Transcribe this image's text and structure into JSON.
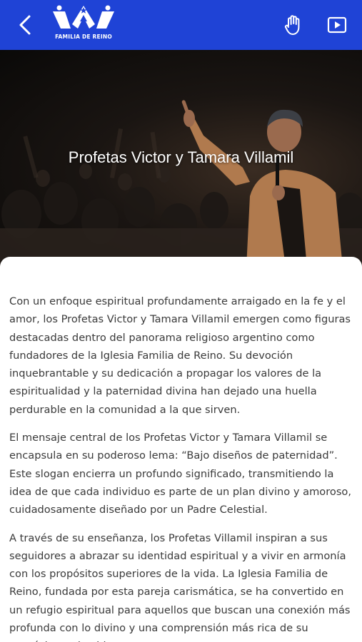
{
  "topbar": {
    "background": "#1f43d6",
    "back_icon": "chevron-left-icon",
    "logo_text": "FAMILIA DE REINO",
    "hand_icon": "hand-icon",
    "play_icon": "play-video-icon"
  },
  "hero": {
    "title": "Profetas Victor y Tamara Villamil"
  },
  "content": {
    "paragraphs": [
      "Con un enfoque espiritual profundamente arraigado en la fe y el amor, los Profetas Victor y Tamara Villamil emergen como figuras destacadas dentro del panorama religioso argentino como fundadores de la Iglesia Familia de Reino. Su devoción inquebrantable y su dedicación a propagar los valores de la espiritualidad y la paternidad divina han dejado una huella perdurable en la comunidad a la que sirven.",
      "El mensaje central de los Profetas Victor y Tamara Villamil se encapsula en su poderoso lema: “Bajo diseños de paternidad”. Este slogan encierra un profundo significado, transmitiendo la idea de que cada individuo es parte de un plan divino y amoroso, cuidadosamente diseñado por un Padre Celestial.",
      "A través de su enseñanza, los Profetas Villamil inspiran a sus seguidores a abrazar su identidad espiritual y a vivir en armonía con los propósitos superiores de la vida. La Iglesia Familia de Reino, fundada por esta pareja carismática, se ha convertido en un refugio espiritual para aquellos que buscan una conexión más profunda con lo divino y una comprensión más rica de su propósito en la vida."
    ]
  }
}
